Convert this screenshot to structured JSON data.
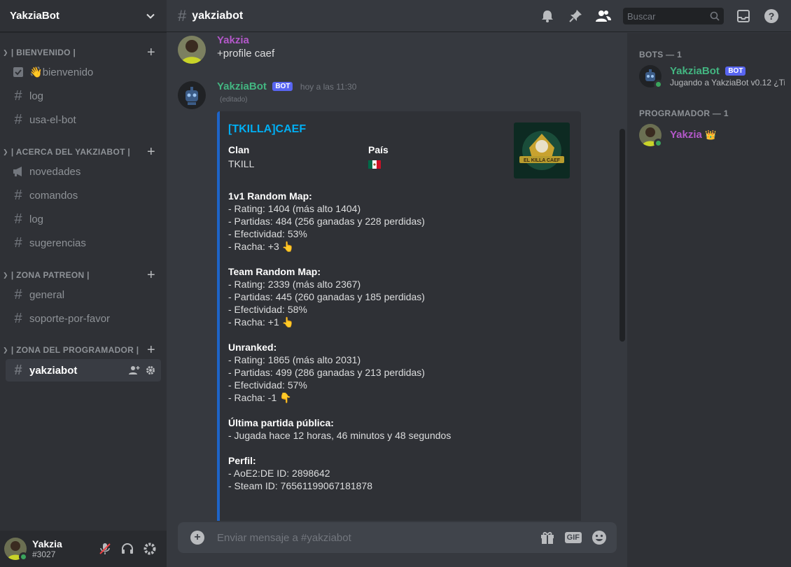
{
  "server": {
    "name": "YakziaBot"
  },
  "categories": [
    {
      "label": "| BIENVENIDO |"
    },
    {
      "label": "| ACERCA DEL YAKZIABOT |"
    },
    {
      "label": "| ZONA PATREON |"
    },
    {
      "label": "| ZONA DEL PROGRAMADOR |"
    }
  ],
  "channels": [
    {
      "label": "bienvenido",
      "emoji": "👋"
    },
    {
      "label": "log"
    },
    {
      "label": "usa-el-bot"
    },
    {
      "label": "novedades"
    },
    {
      "label": "comandos"
    },
    {
      "label": "log"
    },
    {
      "label": "sugerencias"
    },
    {
      "label": "general"
    },
    {
      "label": "soporte-por-favor"
    },
    {
      "label": "yakziabot"
    }
  ],
  "user": {
    "name": "Yakzia",
    "tag": "#3027"
  },
  "header": {
    "channel": "yakziabot",
    "search_placeholder": "Buscar"
  },
  "messages": [
    {
      "author": "Yakzia",
      "author_color": "#b358c9",
      "text": "+profile caef"
    },
    {
      "author": "YakziaBot",
      "author_color": "#43b581",
      "badge": "BOT",
      "timestamp": "hoy a las 11:30",
      "edited": "(editado)"
    }
  ],
  "embed": {
    "title": "[TKILLA]CAEF",
    "border_color": "#1e64c8",
    "fields": [
      {
        "name": "Clan",
        "value": "TKILL"
      },
      {
        "name": "País",
        "value": "🇲🇽"
      }
    ],
    "sections": [
      {
        "heading": "1v1 Random Map:",
        "lines": [
          "- Rating: 1404 (más alto 1404)",
          "- Partidas: 484 (256 ganadas y 228 perdidas)",
          "- Efectividad: 53%",
          "- Racha: +3 👆"
        ]
      },
      {
        "heading": "Team Random Map:",
        "lines": [
          "- Rating: 2339 (más alto 2367)",
          "- Partidas: 445 (260 ganadas y 185 perdidas)",
          "- Efectividad: 58%",
          "- Racha: +1 👆"
        ]
      },
      {
        "heading": "Unranked:",
        "lines": [
          "- Rating: 1865 (más alto 2031)",
          "- Partidas: 499 (286 ganadas y 213 perdidas)",
          "- Efectividad: 57%",
          "- Racha: -1 👇"
        ]
      },
      {
        "heading": "Última partida pública:",
        "lines": [
          "- Jugada hace 12 horas, 46 minutos y 48 segundos"
        ]
      },
      {
        "heading": "Perfil:",
        "lines": [
          "- AoE2:DE ID: 2898642",
          "- Steam ID: 76561199067181878"
        ]
      }
    ]
  },
  "composer": {
    "placeholder": "Enviar mensaje a #yakziabot",
    "gif_label": "GIF"
  },
  "member_groups": [
    {
      "label": "BOTS — 1",
      "members": [
        {
          "name": "YakziaBot",
          "badge": "BOT",
          "activity": "Jugando a YakziaBot v0.12 ¿Ti...",
          "color": "#43b581"
        }
      ]
    },
    {
      "label": "PROGRAMADOR — 1",
      "members": [
        {
          "name": "Yakzia",
          "crown": "👑",
          "color": "#b358c9"
        }
      ]
    }
  ]
}
